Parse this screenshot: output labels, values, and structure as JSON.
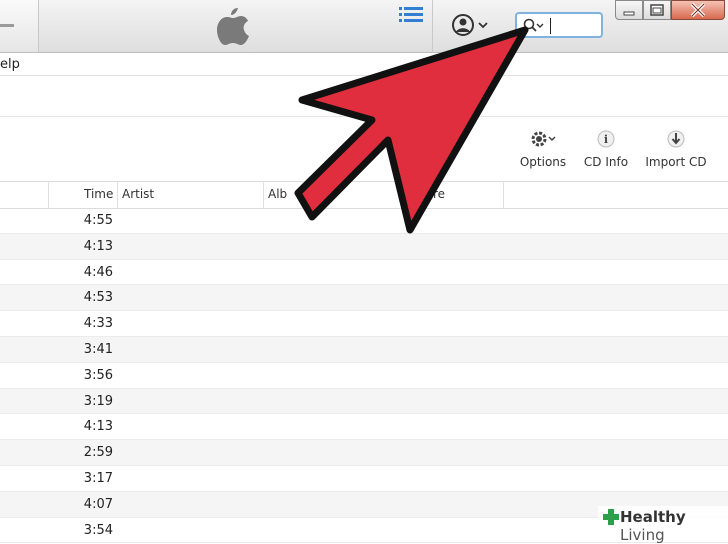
{
  "menu": {
    "partial_label": "elp"
  },
  "toolbar": {
    "options_label": "Options",
    "cdinfo_label": "CD Info",
    "import_label": "Import CD"
  },
  "table": {
    "headers": {
      "time": "Time",
      "artist": "Artist",
      "album_partial": "Alb",
      "genre_partial": "re"
    },
    "rows": [
      {
        "time": "4:55"
      },
      {
        "time": "4:13"
      },
      {
        "time": "4:46"
      },
      {
        "time": "4:53"
      },
      {
        "time": "4:33"
      },
      {
        "time": "3:41"
      },
      {
        "time": "3:56"
      },
      {
        "time": "3:19"
      },
      {
        "time": "4:13"
      },
      {
        "time": "2:59"
      },
      {
        "time": "3:17"
      },
      {
        "time": "4:07"
      },
      {
        "time": "3:54"
      }
    ]
  },
  "watermark": {
    "brand_bold": "Healthy",
    "brand_light": "Living"
  },
  "colors": {
    "arrow_fill": "#e02e3e",
    "search_border": "#7fb2e0",
    "list_icon": "#2f7fd3"
  }
}
